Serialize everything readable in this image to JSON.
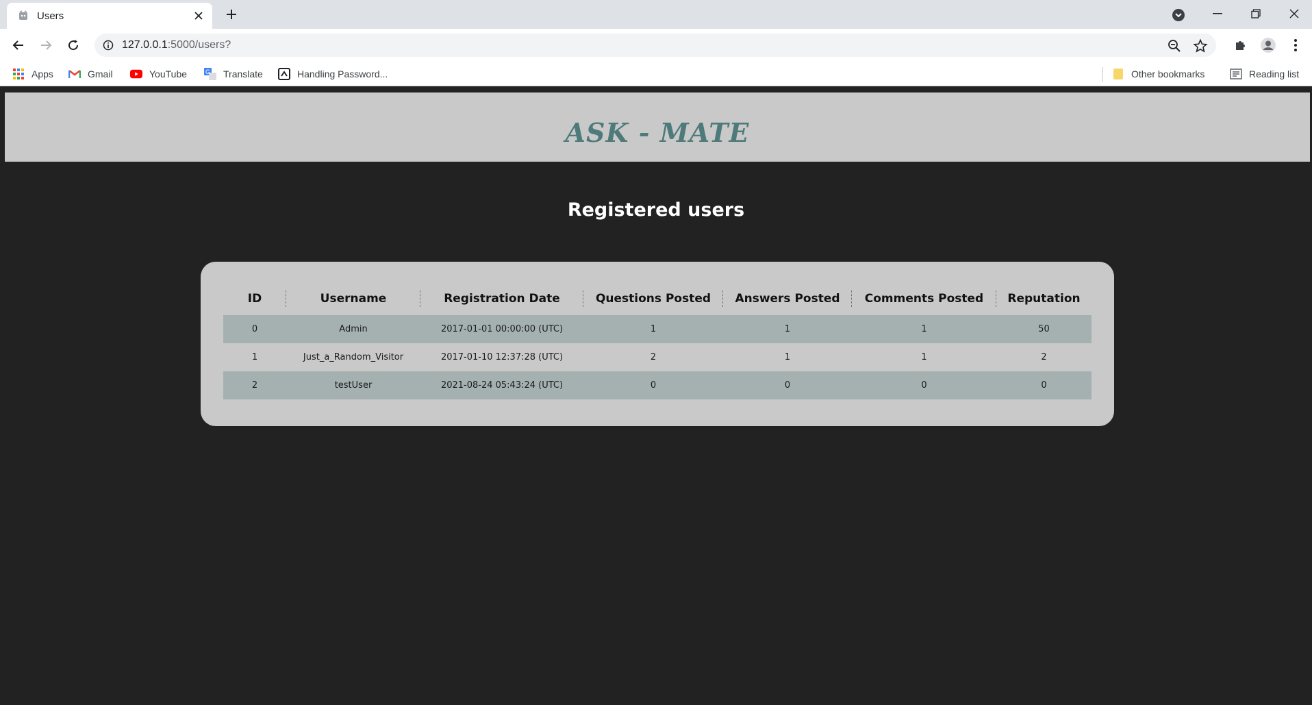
{
  "browser": {
    "tab_title": "Users",
    "url_host": "127.0.0.1",
    "url_path": ":5000/users?",
    "bookmarks": [
      {
        "label": "Apps",
        "icon": "apps-grid-icon"
      },
      {
        "label": "Gmail",
        "icon": "gmail-icon"
      },
      {
        "label": "YouTube",
        "icon": "youtube-icon"
      },
      {
        "label": "Translate",
        "icon": "translate-icon"
      },
      {
        "label": "Handling Password...",
        "icon": "bookmark-page-icon"
      }
    ],
    "other_bookmarks": "Other bookmarks",
    "reading_list": "Reading list"
  },
  "site": {
    "logo": "ASK - MATE"
  },
  "main": {
    "title": "Registered users",
    "table": {
      "headers": [
        "ID",
        "Username",
        "Registration Date",
        "Questions Posted",
        "Answers Posted",
        "Comments Posted",
        "Reputation"
      ],
      "rows": [
        [
          "0",
          "Admin",
          "2017-01-01 00:00:00 (UTC)",
          "1",
          "1",
          "1",
          "50"
        ],
        [
          "1",
          "Just_a_Random_Visitor",
          "2017-01-10 12:37:28 (UTC)",
          "2",
          "1",
          "1",
          "2"
        ],
        [
          "2",
          "testUser",
          "2021-08-24 05:43:24 (UTC)",
          "0",
          "0",
          "0",
          "0"
        ]
      ]
    }
  },
  "colors": {
    "page_bg": "#222222",
    "header_bg": "#c9c9c9",
    "logo": "#4e7a79",
    "row_stripe": "#a5b1b1"
  }
}
